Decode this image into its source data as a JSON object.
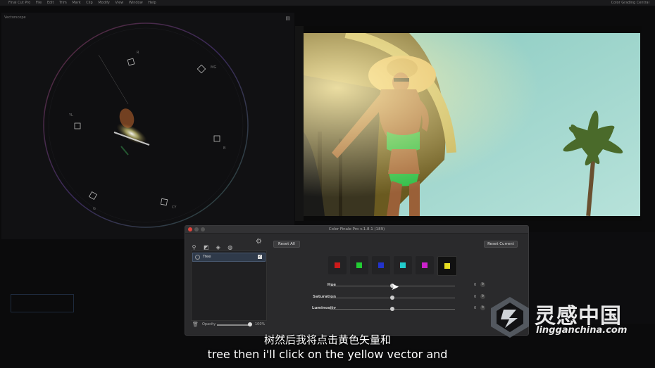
{
  "menubar": {
    "app": "Final Cut Pro",
    "items": [
      "File",
      "Edit",
      "Trim",
      "Mark",
      "Clip",
      "Modify",
      "View",
      "Window",
      "Help"
    ],
    "status": "Color Grading Central"
  },
  "scope": {
    "title": "Vectorscope",
    "label_r": "R",
    "label_mg": "MG",
    "label_b": "B",
    "label_cy": "CY",
    "label_g": "G",
    "label_yl": "YL"
  },
  "panel": {
    "title": "Color Finale Pro v.1.8.1 (189)",
    "reset_all": "Reset All",
    "reset_current": "Reset Current",
    "layer_name": "Tree",
    "opacity_label": "Opacity",
    "opacity_value": "100%",
    "swatches": [
      {
        "name": "red",
        "color": "#cc1a1a"
      },
      {
        "name": "green",
        "color": "#22cc33"
      },
      {
        "name": "blue",
        "color": "#2233cc"
      },
      {
        "name": "cyan",
        "color": "#22cccc"
      },
      {
        "name": "magenta",
        "color": "#cc22cc"
      },
      {
        "name": "yellow",
        "color": "#e6dd22"
      }
    ],
    "active_swatch": "yellow",
    "sliders": [
      {
        "label": "Hue",
        "value": "0",
        "position": 0.5
      },
      {
        "label": "Saturation",
        "value": "0",
        "position": 0.5
      },
      {
        "label": "Luminosity",
        "value": "0",
        "position": 0.5
      }
    ]
  },
  "subtitles": {
    "zh": "树然后我将点击黄色矢量和",
    "en": "tree then i'll click on the yellow vector and"
  },
  "watermark": {
    "cn": "灵感中国",
    "url": "lingganchina.com"
  }
}
